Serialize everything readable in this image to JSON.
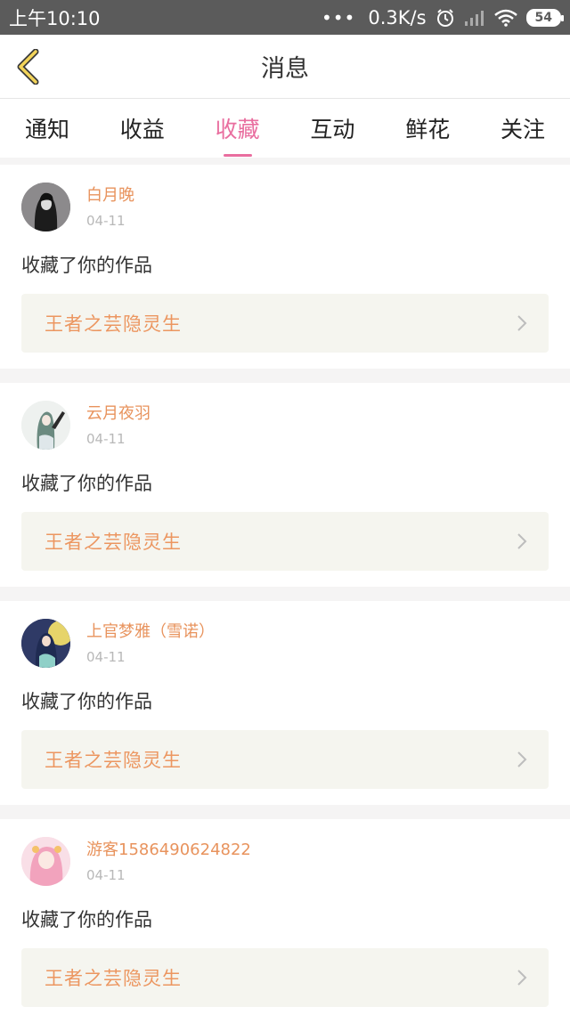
{
  "status_bar": {
    "time": "上午10:10",
    "network_speed": "0.3K/s",
    "battery": "54",
    "icons": [
      "dots-icon",
      "alarm-icon",
      "signal-icon",
      "wifi-icon",
      "battery-icon"
    ]
  },
  "header": {
    "title": "消息",
    "back_icon": "chevron-left-icon"
  },
  "tabs": [
    {
      "label": "通知",
      "active": false
    },
    {
      "label": "收益",
      "active": false
    },
    {
      "label": "收藏",
      "active": true
    },
    {
      "label": "互动",
      "active": false
    },
    {
      "label": "鲜花",
      "active": false
    },
    {
      "label": "关注",
      "active": false
    }
  ],
  "messages": [
    {
      "username": "白月晚",
      "date": "04-11",
      "text": "收藏了你的作品",
      "work_title": "王者之芸隐灵生"
    },
    {
      "username": "云月夜羽",
      "date": "04-11",
      "text": "收藏了你的作品",
      "work_title": "王者之芸隐灵生"
    },
    {
      "username": "上官梦雅（雪诺）",
      "date": "04-11",
      "text": "收藏了你的作品",
      "work_title": "王者之芸隐灵生"
    },
    {
      "username": "游客1586490624822",
      "date": "04-11",
      "text": "收藏了你的作品",
      "work_title": "王者之芸隐灵生"
    }
  ],
  "colors": {
    "accent_pink": "#e96e9f",
    "username_orange": "#e8935d",
    "work_title_orange": "#ec9660",
    "back_icon_yellow": "#f3d45a"
  }
}
